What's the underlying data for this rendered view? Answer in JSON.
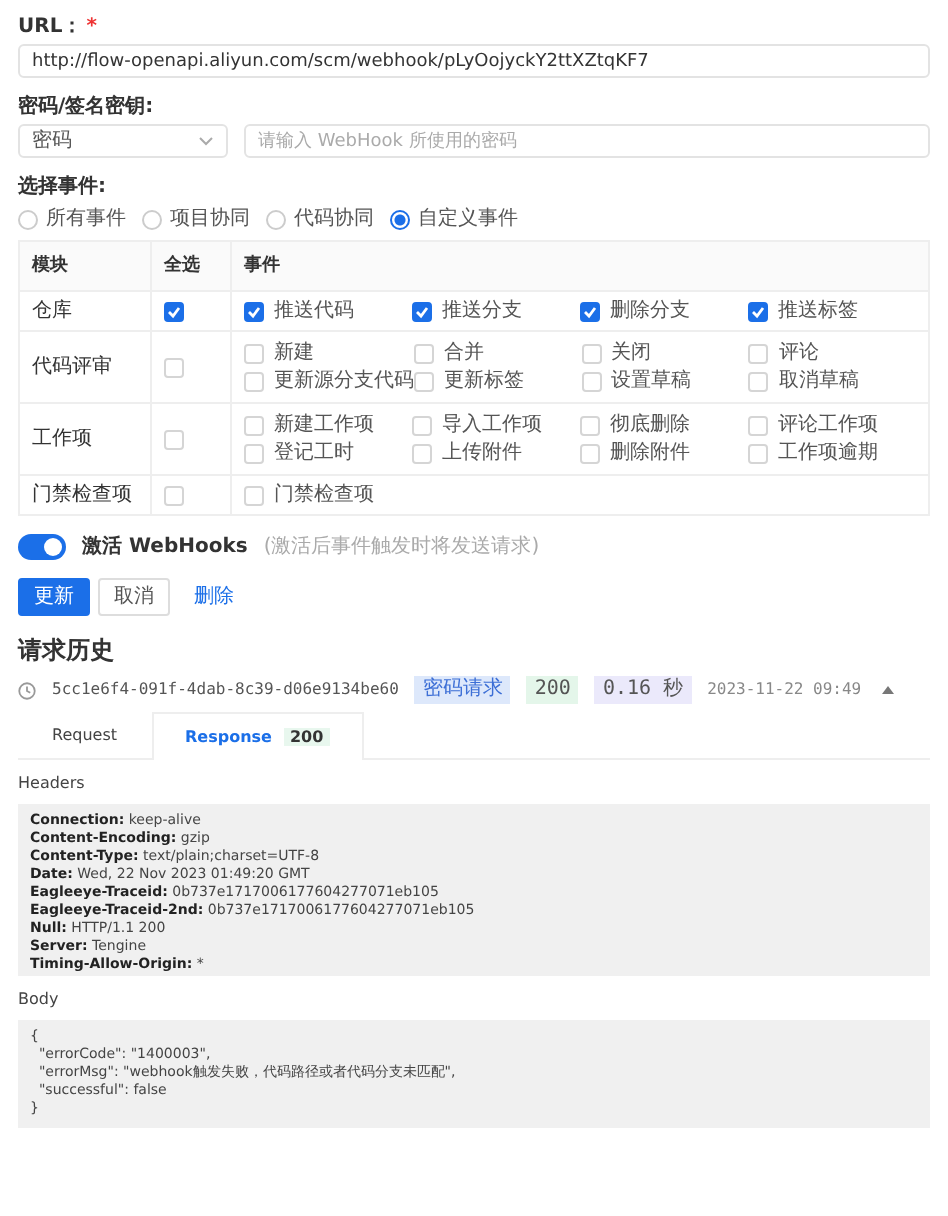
{
  "url": {
    "label": "URL：",
    "required_mark": "*",
    "value": "http://flow-openapi.aliyun.com/scm/webhook/pLyOojyckY2ttXZtqKF7"
  },
  "secret": {
    "label": "密码/签名密钥:",
    "type_select": "密码",
    "placeholder": "请输入 WebHook 所使用的密码"
  },
  "events": {
    "label": "选择事件:",
    "options": [
      {
        "label": "所有事件",
        "selected": false
      },
      {
        "label": "项目协同",
        "selected": false
      },
      {
        "label": "代码协同",
        "selected": false
      },
      {
        "label": "自定义事件",
        "selected": true
      }
    ],
    "table": {
      "columns": [
        "模块",
        "全选",
        "事件"
      ],
      "rows": [
        {
          "module": "仓库",
          "all_checked": true,
          "events": [
            {
              "label": "推送代码",
              "checked": true
            },
            {
              "label": "推送分支",
              "checked": true
            },
            {
              "label": "删除分支",
              "checked": true
            },
            {
              "label": "推送标签",
              "checked": true
            }
          ]
        },
        {
          "module": "代码评审",
          "all_checked": false,
          "events": [
            {
              "label": "新建",
              "checked": false
            },
            {
              "label": "合并",
              "checked": false
            },
            {
              "label": "关闭",
              "checked": false
            },
            {
              "label": "评论",
              "checked": false
            },
            {
              "label": "更新源分支代码",
              "checked": false
            },
            {
              "label": "更新标签",
              "checked": false
            },
            {
              "label": "设置草稿",
              "checked": false
            },
            {
              "label": "取消草稿",
              "checked": false
            }
          ]
        },
        {
          "module": "工作项",
          "all_checked": false,
          "events": [
            {
              "label": "新建工作项",
              "checked": false
            },
            {
              "label": "导入工作项",
              "checked": false
            },
            {
              "label": "彻底删除",
              "checked": false
            },
            {
              "label": "评论工作项",
              "checked": false
            },
            {
              "label": "登记工时",
              "checked": false
            },
            {
              "label": "上传附件",
              "checked": false
            },
            {
              "label": "删除附件",
              "checked": false
            },
            {
              "label": "工作项逾期",
              "checked": false
            }
          ]
        },
        {
          "module": "门禁检查项",
          "all_checked": false,
          "events": [
            {
              "label": "门禁检查项",
              "checked": false
            }
          ]
        }
      ]
    }
  },
  "activate": {
    "on": true,
    "label": "激活 WebHooks",
    "hint": "(激活后事件触发时将发送请求)"
  },
  "buttons": [
    {
      "label": "更新",
      "kind": "primary"
    },
    {
      "label": "取消",
      "kind": "secondary"
    },
    {
      "label": "删除",
      "kind": "link"
    }
  ],
  "history": {
    "title": "请求历史",
    "entry": {
      "id": "5cc1e6f4-091f-4dab-8c39-d06e9134be60",
      "type_tag": "密码请求",
      "status": "200",
      "duration": "0.16 秒",
      "time": "2023-11-22 09:49",
      "expanded": true
    },
    "tabs": [
      {
        "label": "Request",
        "selected": false
      },
      {
        "label": "Response",
        "badge": "200",
        "selected": true
      }
    ],
    "headers_title": "Headers",
    "headers": [
      {
        "name": "Connection:",
        "value": "keep-alive"
      },
      {
        "name": "Content-Encoding:",
        "value": "gzip"
      },
      {
        "name": "Content-Type:",
        "value": "text/plain;charset=UTF-8"
      },
      {
        "name": "Date:",
        "value": "Wed, 22 Nov 2023 01:49:20 GMT"
      },
      {
        "name": "Eagleeye-Traceid:",
        "value": "0b737e1717006177604277071eb105"
      },
      {
        "name": "Eagleeye-Traceid-2nd:",
        "value": "0b737e1717006177604277071eb105"
      },
      {
        "name": "Null:",
        "value": "HTTP/1.1 200"
      },
      {
        "name": "Server:",
        "value": "Tengine"
      },
      {
        "name": "Timing-Allow-Origin:",
        "value": "*"
      }
    ],
    "body_title": "Body",
    "body": [
      "{",
      "  \"errorCode\": \"1400003\",",
      "  \"errorMsg\": \"webhook触发失败，代码路径或者代码分支未匹配\",",
      "  \"successful\": false",
      "}"
    ]
  }
}
